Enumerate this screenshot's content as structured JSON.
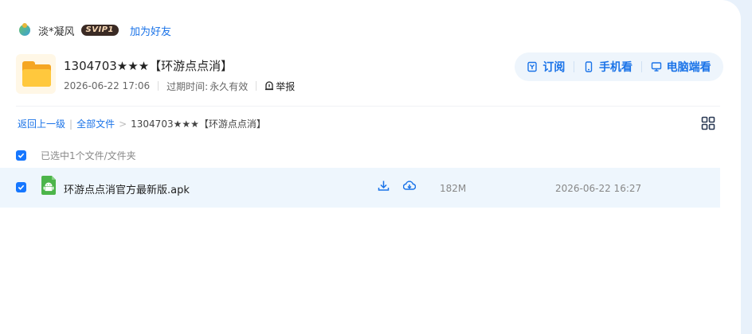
{
  "user": {
    "name": "淡*凝风",
    "vip_badge": "SVIP1",
    "add_friend": "加为好友"
  },
  "share": {
    "title": "1304703★★★【环游点点消】",
    "date": "2026-06-22 17:06",
    "expire_label": "过期时间:",
    "expire_value": "永久有效",
    "report": "举报"
  },
  "actions": {
    "subscribe": "订阅",
    "mobile": "手机看",
    "desktop": "电脑端看"
  },
  "breadcrumb": {
    "back": "返回上一级",
    "sep1": "|",
    "all_files": "全部文件",
    "sep2": ">",
    "current": "1304703★★★【环游点点消】"
  },
  "selection": {
    "text": "已选中1个文件/文件夹"
  },
  "files": [
    {
      "name": "环游点点消官方最新版.apk",
      "size": "182M",
      "date": "2026-06-22 16:27",
      "icon": "android-apk-icon"
    }
  ],
  "colors": {
    "accent": "#1a73e8",
    "checkbox": "#1677ff",
    "row_highlight": "#eef6fd",
    "vip_bg": "#3a2a24"
  }
}
